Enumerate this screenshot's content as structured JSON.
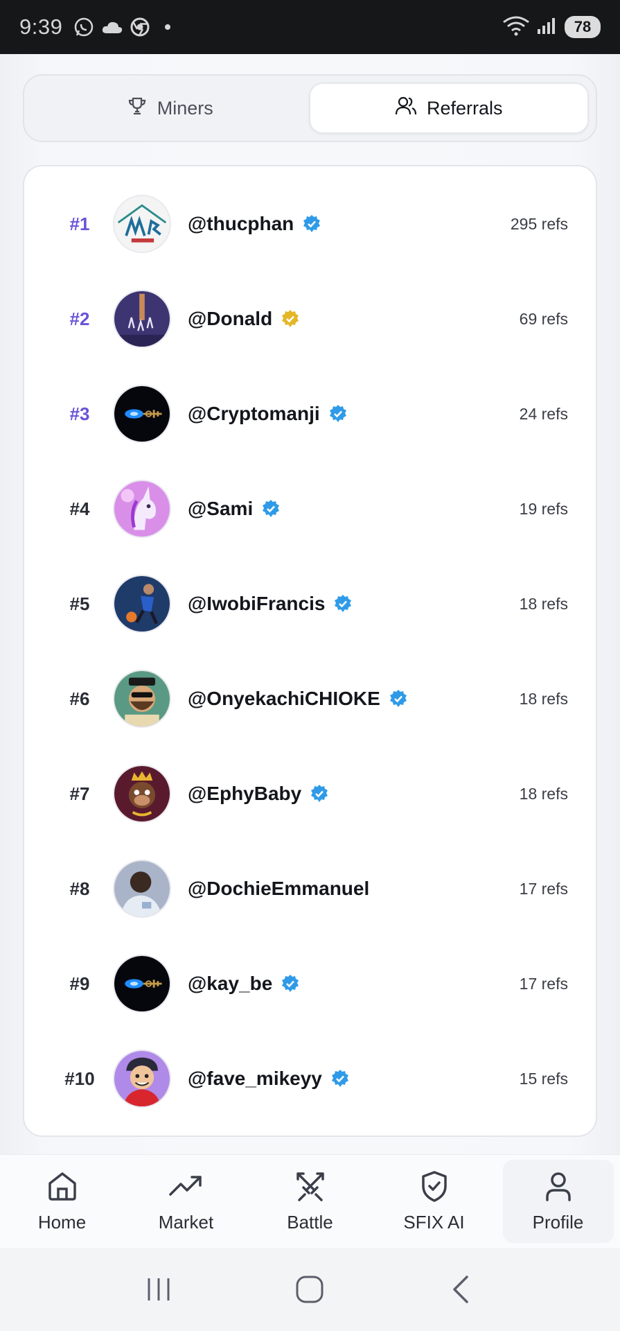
{
  "status_bar": {
    "time": "9:39",
    "battery": "78",
    "icons_left": [
      "whatsapp-icon",
      "cloud-icon",
      "chrome-icon",
      "dot-icon"
    ],
    "icons_right": [
      "wifi-icon",
      "signal-icon",
      "battery-icon"
    ]
  },
  "tabs": [
    {
      "label": "Miners",
      "icon": "trophy-icon",
      "active": false
    },
    {
      "label": "Referrals",
      "icon": "users-icon",
      "active": true
    }
  ],
  "leaderboard": [
    {
      "rank": "#1",
      "username": "@thucphan",
      "verified": "blue",
      "refs": "295 refs"
    },
    {
      "rank": "#2",
      "username": "@Donald",
      "verified": "gold",
      "refs": "69 refs"
    },
    {
      "rank": "#3",
      "username": "@Cryptomanji",
      "verified": "blue",
      "refs": "24 refs"
    },
    {
      "rank": "#4",
      "username": "@Sami",
      "verified": "blue",
      "refs": "19 refs"
    },
    {
      "rank": "#5",
      "username": "@IwobiFrancis",
      "verified": "blue",
      "refs": "18 refs"
    },
    {
      "rank": "#6",
      "username": "@OnyekachiCHIOKE",
      "verified": "blue",
      "refs": "18 refs"
    },
    {
      "rank": "#7",
      "username": "@EphyBaby",
      "verified": "blue",
      "refs": "18 refs"
    },
    {
      "rank": "#8",
      "username": "@DochieEmmanuel",
      "verified": "none",
      "refs": "17 refs"
    },
    {
      "rank": "#9",
      "username": "@kay_be",
      "verified": "blue",
      "refs": "17 refs"
    },
    {
      "rank": "#10",
      "username": "@fave_mikeyy",
      "verified": "blue",
      "refs": "15 refs"
    }
  ],
  "bottom_nav": [
    {
      "label": "Home",
      "icon": "home-icon"
    },
    {
      "label": "Market",
      "icon": "trending-up-icon"
    },
    {
      "label": "Battle",
      "icon": "swords-icon"
    },
    {
      "label": "SFIX AI",
      "icon": "shield-check-icon"
    },
    {
      "label": "Profile",
      "icon": "user-icon",
      "active": true
    }
  ],
  "system_nav": [
    "recent-apps-icon",
    "home-circle-icon",
    "back-icon"
  ],
  "colors": {
    "accent_rank": "#6a52d8",
    "verified_blue": "#2f9be8",
    "verified_gold": "#e4b728"
  }
}
